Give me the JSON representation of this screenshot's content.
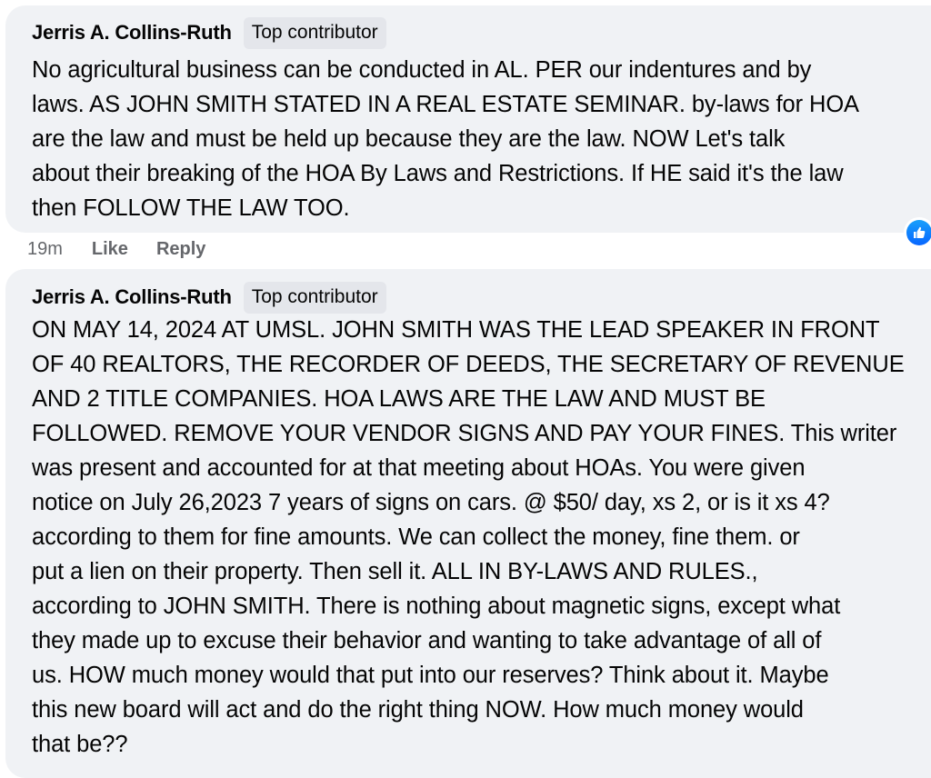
{
  "comments": [
    {
      "author": "Jerris A. Collins-Ruth",
      "badge": "Top contributor",
      "lines": [
        "No agricultural business can be conducted in AL. PER our indentures and by",
        "laws. AS JOHN SMITH STATED IN A REAL ESTATE SEMINAR. by-laws for HOA",
        "are the law and must be held up because they are the law. NOW Let's talk",
        "about their breaking of the HOA By Laws and Restrictions. If HE said it's the law",
        "then FOLLOW THE LAW TOO."
      ],
      "time": "19m",
      "like_label": "Like",
      "reply_label": "Reply",
      "reaction_icon": "like-icon",
      "reaction_color": "#0866ff"
    },
    {
      "author": "Jerris A. Collins-Ruth",
      "badge": "Top contributor",
      "lines": [
        "ON MAY 14, 2024 AT UMSL. JOHN SMITH WAS THE LEAD SPEAKER IN FRONT",
        "OF 40 REALTORS, THE RECORDER OF DEEDS, THE SECRETARY OF REVENUE",
        "AND 2 TITLE COMPANIES. HOA LAWS ARE THE LAW AND MUST BE",
        "FOLLOWED. REMOVE YOUR VENDOR SIGNS AND PAY YOUR FINES. This writer",
        "was present and accounted for at that meeting about HOAs. You were given",
        "notice on July 26,2023 7 years of signs on cars. @ $50/ day, xs 2, or is it xs 4?",
        "according to them for fine amounts. We can collect the money, fine them. or",
        "put a lien on their property. Then sell it. ALL IN BY-LAWS AND RULES.,",
        "according to JOHN SMITH. There is nothing about magnetic signs, except what",
        "they made up to excuse their behavior and wanting to take advantage of all of",
        "us. HOW much money would that put into our reserves? Think about it. Maybe",
        "this new board will act and do the right thing NOW. How much money would",
        "that be??"
      ]
    }
  ]
}
